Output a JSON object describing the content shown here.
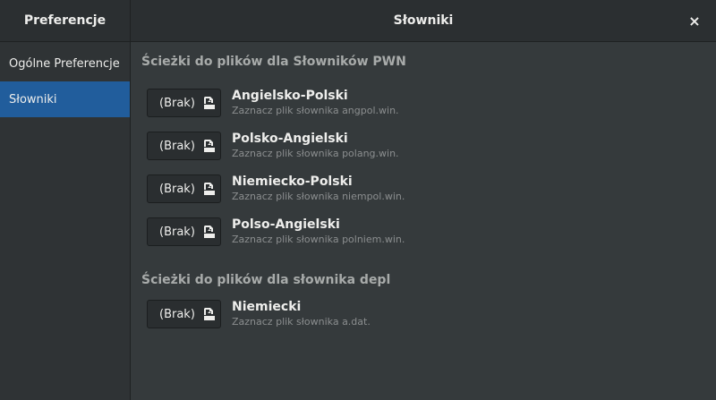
{
  "window": {
    "sidebar_title": "Preferencje",
    "title": "Słowniki",
    "close_symbol": "×"
  },
  "sidebar": {
    "items": [
      {
        "label": "Ogólne Preferencje",
        "active": false
      },
      {
        "label": "Słowniki",
        "active": true
      }
    ]
  },
  "sections": [
    {
      "title": "Ścieżki do  plików dla Słowników PWN",
      "rows": [
        {
          "button": "(Brak)",
          "icon": "file-open-icon",
          "name": "Angielsko-Polski",
          "hint": "Zaznacz plik słownika angpol.win."
        },
        {
          "button": "(Brak)",
          "icon": "file-open-icon",
          "name": "Polsko-Angielski",
          "hint": "Zaznacz plik słownika polang.win."
        },
        {
          "button": "(Brak)",
          "icon": "file-open-icon",
          "name": "Niemiecko-Polski",
          "hint": "Zaznacz plik słownika niempol.win."
        },
        {
          "button": "(Brak)",
          "icon": "file-open-icon",
          "name": "Polso-Angielski",
          "hint": "Zaznacz plik słownika polniem.win."
        }
      ]
    },
    {
      "title": "Ścieżki do plików dla słownika depl",
      "rows": [
        {
          "button": "(Brak)",
          "icon": "file-open-icon",
          "name": "Niemiecki",
          "hint": "Zaznacz plik słownika a.dat."
        }
      ]
    }
  ]
}
